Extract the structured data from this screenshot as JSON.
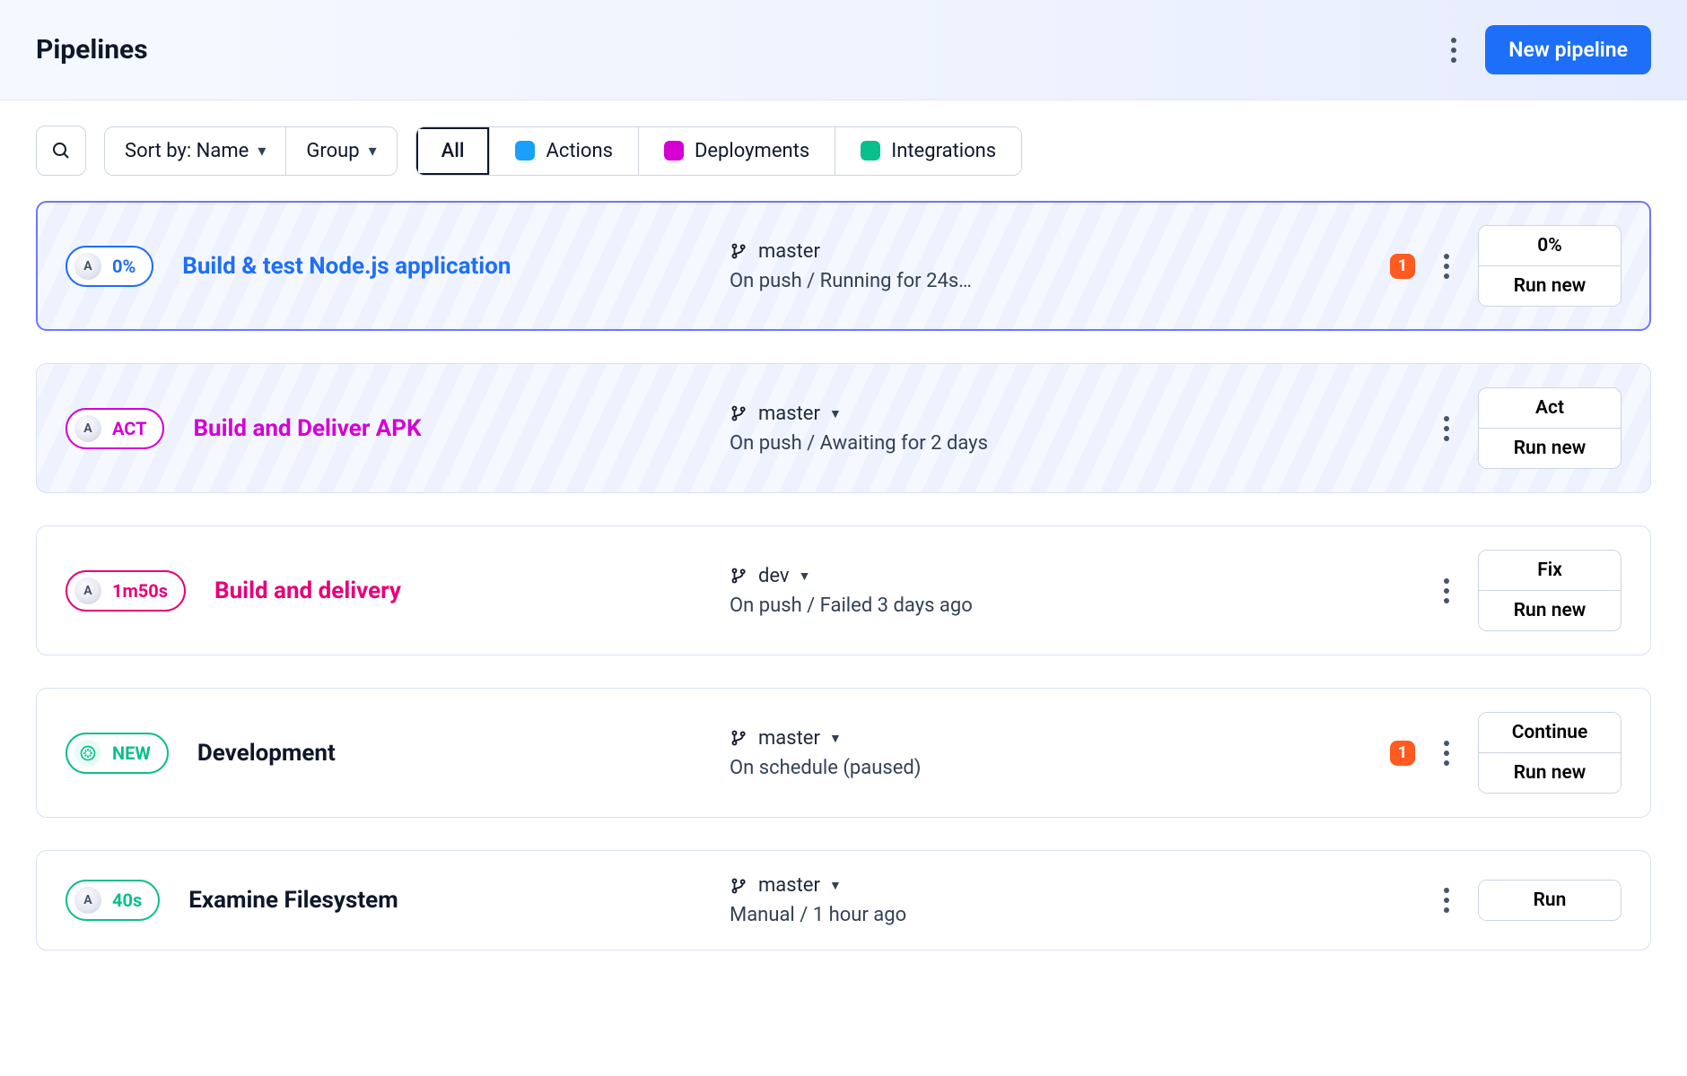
{
  "header": {
    "title": "Pipelines",
    "new_pipeline_label": "New pipeline"
  },
  "toolbar": {
    "sort_label": "Sort by: Name",
    "group_label": "Group",
    "filters": {
      "all": "All",
      "actions": "Actions",
      "deployments": "Deployments",
      "integrations": "Integrations"
    },
    "filter_colors": {
      "actions": "#18a0fb",
      "deployments": "#d400d4",
      "integrations": "#0abf8c"
    }
  },
  "pipelines": [
    {
      "pill_text": "0%",
      "pill_color": "#1d6ff7",
      "title": "Build & test Node.js application",
      "title_color": "#1d6ff7",
      "branch": "master",
      "branch_has_caret": false,
      "status": "On push / Running for 24s…",
      "alert_count": "1",
      "actions": [
        "0%",
        "Run new"
      ],
      "striped": true,
      "active": true,
      "avatar": "A"
    },
    {
      "pill_text": "ACT",
      "pill_color": "#d400d4",
      "title": "Build and Deliver APK",
      "title_color": "#d400d4",
      "branch": "master",
      "branch_has_caret": true,
      "status": "On push / Awaiting for 2 days",
      "alert_count": null,
      "actions": [
        "Act",
        "Run new"
      ],
      "striped": true,
      "active": false,
      "avatar": "A"
    },
    {
      "pill_text": "1m50s",
      "pill_color": "#e6007a",
      "title": "Build and delivery",
      "title_color": "#e6007a",
      "branch": "dev",
      "branch_has_caret": true,
      "status": "On push / Failed 3 days ago",
      "alert_count": null,
      "actions": [
        "Fix",
        "Run new"
      ],
      "striped": false,
      "active": false,
      "avatar": "A"
    },
    {
      "pill_text": "NEW",
      "pill_color": "#0abf8c",
      "title": "Development",
      "title_color": "#0f172a",
      "branch": "master",
      "branch_has_caret": true,
      "status": "On schedule (paused)",
      "alert_count": "1",
      "actions": [
        "Continue",
        "Run new"
      ],
      "striped": false,
      "active": false,
      "avatar": "gear"
    },
    {
      "pill_text": "40s",
      "pill_color": "#0abf8c",
      "title": "Examine Filesystem",
      "title_color": "#0f172a",
      "branch": "master",
      "branch_has_caret": true,
      "status": "Manual / 1 hour ago",
      "alert_count": null,
      "actions": [
        "Run"
      ],
      "striped": false,
      "active": false,
      "avatar": "A"
    }
  ]
}
